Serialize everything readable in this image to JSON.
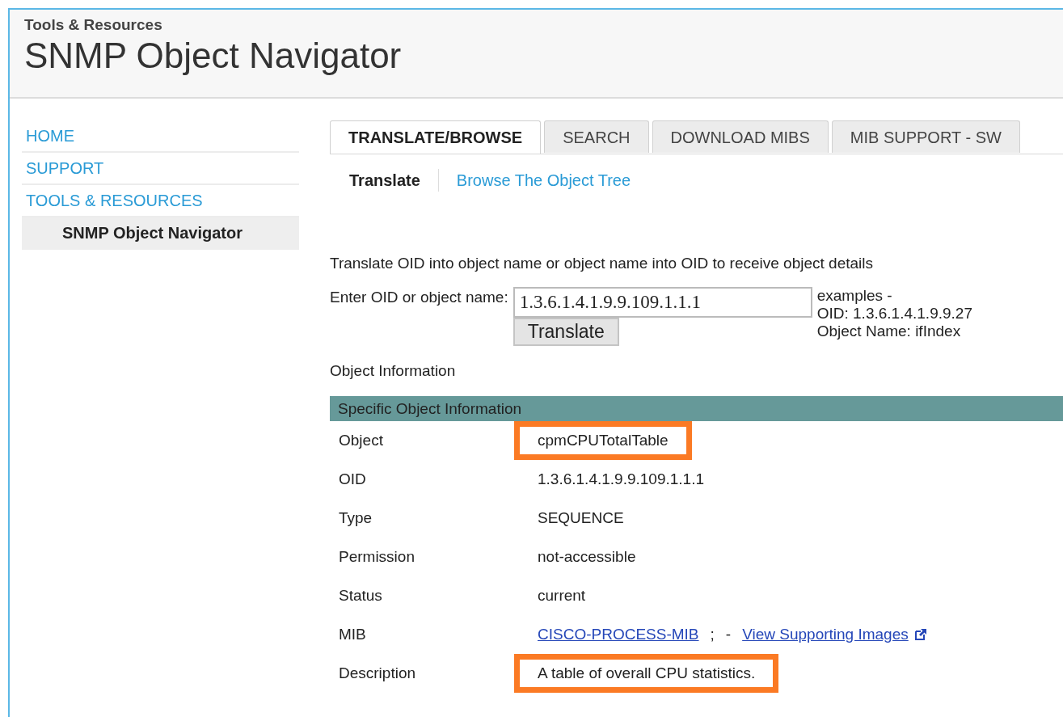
{
  "header": {
    "eyebrow": "Tools & Resources",
    "title": "SNMP Object Navigator"
  },
  "sidebar": {
    "items": [
      {
        "label": "HOME",
        "selected": false
      },
      {
        "label": "SUPPORT",
        "selected": false
      },
      {
        "label": "TOOLS & RESOURCES",
        "selected": false
      },
      {
        "label": "SNMP Object Navigator",
        "selected": true
      }
    ]
  },
  "tabs": [
    {
      "label": "TRANSLATE/BROWSE",
      "selected": true
    },
    {
      "label": "SEARCH",
      "selected": false
    },
    {
      "label": "DOWNLOAD MIBS",
      "selected": false
    },
    {
      "label": "MIB SUPPORT - SW",
      "selected": false
    }
  ],
  "subtabs": [
    {
      "label": "Translate",
      "selected": true
    },
    {
      "label": "Browse The Object Tree",
      "selected": false
    }
  ],
  "intro": "Translate OID into object name or object name into OID to receive object details",
  "form": {
    "label": "Enter OID or object name:",
    "value": "1.3.6.1.4.1.9.9.109.1.1.1",
    "button": "Translate",
    "examples": [
      "examples -",
      "OID: 1.3.6.1.4.1.9.9.27",
      "Object Name: ifIndex"
    ]
  },
  "section_label": "Object Information",
  "table": {
    "title": "Specific Object Information",
    "rows": [
      {
        "label": "Object",
        "highlighted": true,
        "parts": [
          {
            "kind": "text",
            "text": "cpmCPUTotalTable"
          }
        ]
      },
      {
        "label": "OID",
        "highlighted": false,
        "parts": [
          {
            "kind": "text",
            "text": "1.3.6.1.4.1.9.9.109.1.1.1"
          }
        ]
      },
      {
        "label": "Type",
        "highlighted": false,
        "parts": [
          {
            "kind": "text",
            "text": "SEQUENCE"
          }
        ]
      },
      {
        "label": "Permission",
        "highlighted": false,
        "parts": [
          {
            "kind": "text",
            "text": "not-accessible"
          }
        ]
      },
      {
        "label": "Status",
        "highlighted": false,
        "parts": [
          {
            "kind": "text",
            "text": "current"
          }
        ]
      },
      {
        "label": "MIB",
        "highlighted": false,
        "parts": [
          {
            "kind": "link",
            "text": "CISCO-PROCESS-MIB"
          },
          {
            "kind": "text",
            "text": ";"
          },
          {
            "kind": "text",
            "text": "-"
          },
          {
            "kind": "external_link",
            "text": "View Supporting Images"
          }
        ]
      },
      {
        "label": "Description",
        "highlighted": true,
        "parts": [
          {
            "kind": "text",
            "text": "A table of overall CPU statistics."
          }
        ]
      }
    ]
  }
}
